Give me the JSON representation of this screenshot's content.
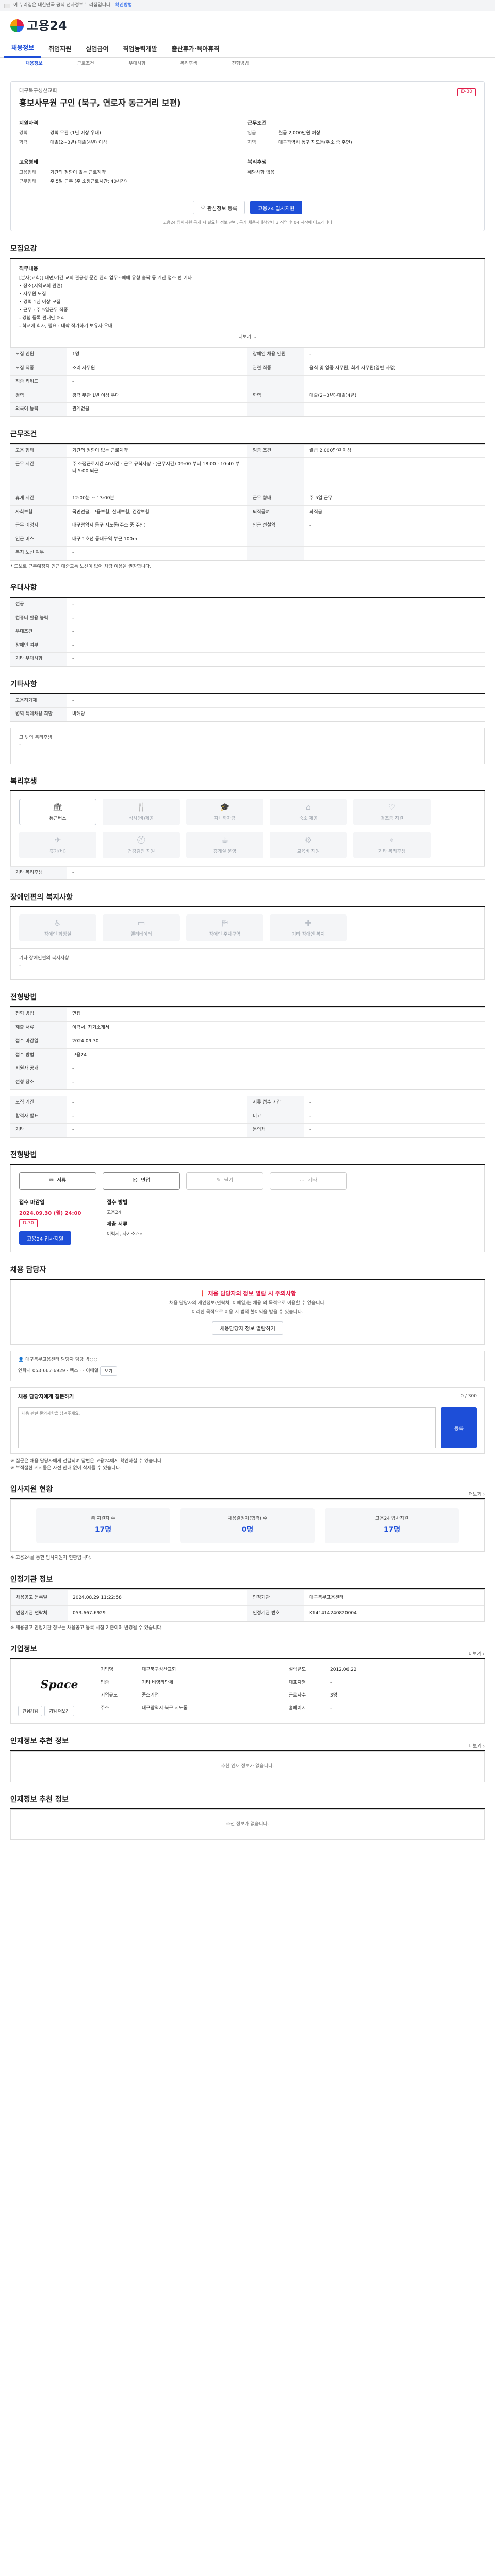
{
  "topbar": {
    "notice": "이 누리집은 대한민국 공식 전자정부 누리집입니다.",
    "how": "확인방법"
  },
  "brand": {
    "name": "고용24"
  },
  "nav": [
    "채용정보",
    "취업지원",
    "실업급여",
    "직업능력개발",
    "출산휴가·육아휴직"
  ],
  "subnav": [
    "채용정보",
    "근로조건",
    "우대사항",
    "복리후생",
    "전형방법"
  ],
  "hero": {
    "company": "대구북구성산교회",
    "dday": "D-30",
    "title": "홍보사무원 구인 (북구, 연로자 동근거리 보편)",
    "qual_h": "지원자격",
    "qual": [
      {
        "k": "경력",
        "v": "경력 무관 (1년 이상 우대)"
      },
      {
        "k": "학력",
        "v": "대졸(2~3년)·대졸(4년) 이상"
      }
    ],
    "cond_h": "근무조건",
    "cond": [
      {
        "k": "임금",
        "v": "월급 2,000만원 이상"
      },
      {
        "k": "지역",
        "v": "대구광역시 동구 지도동(주소 중 주인)"
      }
    ],
    "form_h": "고용형태",
    "form": [
      {
        "k": "고용형태",
        "v": "기간의 정함이 없는 근로계약"
      },
      {
        "k": "근무형태",
        "v": "주 5일 근무 (주 소정근로시간: 40시간)"
      }
    ],
    "welfare_h": "복리후생",
    "welfare": [
      {
        "k": "",
        "v": "해당사항 없음"
      }
    ],
    "btn_save": "관심정보 등록",
    "btn_apply": "고용24 입사지원",
    "note": "고용24 입사지원 공개 시 필요한 정보 관련, 공개 채용시대책안내 3 직업 후 04 시작에 에드리니다"
  },
  "recruit": {
    "title": "모집요강",
    "desc_head": "직무내용",
    "desc": [
      "[본사(교회)] 대면/기간 교회 관공청 문건 관리 업무~매매 유형 홀짝 등 계산 업소 편 기타",
      "• 장소(지역교회 관련)",
      "• 사무원 모집",
      "• 경력 1년 이상 모집",
      "• 근무 : 주 5일근무 직종",
      "- 경험 등록 관내만 처리",
      "- 학교에 회사, 필요 : 대학 작가하기 보유자 우대"
    ],
    "more": "더보기",
    "rows": [
      [
        "모집 인원",
        "1명",
        "장애인 채용 인원",
        "-"
      ],
      [
        "모집 직종",
        "조리 사무원",
        "관련 직종",
        "음식 및 업종 사무원, 회계 사무원(일반 사업)"
      ],
      [
        "직종 키워드",
        "-",
        "",
        ""
      ],
      [
        "경력",
        "경력 무관 1년 이상 우대",
        "학력",
        "대졸(2~3년)·대졸(4년)"
      ],
      [
        "외국어 능력",
        "관계없음",
        "",
        ""
      ]
    ]
  },
  "conditions": {
    "title": "근무조건",
    "rows": [
      [
        "고용 형태",
        "기간의 정함이 없는 근로계약",
        "임금 조건",
        "월급 2,000만원 이상"
      ],
      [
        "근무 시간",
        "주 소정근로시간 40시간 · 근무 규칙사항 · (근무시간) 09:00 부터 18:00 · 10:40 부터 5:00 퇴근",
        "",
        ""
      ],
      [
        "휴게 시간",
        "12:00분 ~ 13:00분",
        "근무 형태",
        "주 5일 근무"
      ],
      [
        "사회보험",
        "국민연금, 고용보험, 산재보험, 건강보험",
        "퇴직급여",
        "퇴직금"
      ],
      [
        "근무 예정지",
        "대구광역시 동구 지도동(주소 중 주인)",
        "인근 전철역",
        "-"
      ],
      [
        "인근 버스",
        "대구 1호선 동대구역 부근 100m",
        "",
        ""
      ],
      [
        "복지 노선 여부",
        "-",
        "",
        ""
      ]
    ],
    "note": "* 도보로 근무예정지 인근 대중교통 노선이 없어 차량 이용을 권장합니다."
  },
  "preference": {
    "title": "우대사항",
    "rows": [
      [
        "전공",
        "-"
      ],
      [
        "컴퓨터 활용 능력",
        "-"
      ],
      [
        "우대조건",
        "-"
      ],
      [
        "장애인 여부",
        "-"
      ],
      [
        "기타 우대사항",
        "-"
      ]
    ]
  },
  "other": {
    "title": "기타사항",
    "rows": [
      [
        "고용허가제",
        "-"
      ],
      [
        "병역 특례채용 희망",
        "비해당"
      ]
    ],
    "extra_label": "그 밖의 복리후생",
    "extra_value": "-"
  },
  "welfare": {
    "title": "복리후생",
    "items": [
      {
        "icon": "🏛",
        "label": "통근버스",
        "on": true
      },
      {
        "icon": "🍴",
        "label": "식사(비)제공",
        "on": false
      },
      {
        "icon": "🎓",
        "label": "자녀학자금",
        "on": false
      },
      {
        "icon": "⌂",
        "label": "숙소 제공",
        "on": false
      },
      {
        "icon": "♡",
        "label": "경조금 지원",
        "on": false
      },
      {
        "icon": "✈",
        "label": "휴가(비)",
        "on": false
      },
      {
        "icon": "⛑",
        "label": "건강검진 지원",
        "on": false
      },
      {
        "icon": "☕",
        "label": "휴게실 운영",
        "on": false
      },
      {
        "icon": "⚙",
        "label": "교육비 지원",
        "on": false
      },
      {
        "icon": "⌖",
        "label": "기타 복리후생",
        "on": false
      }
    ],
    "extra_label": "기타 복리후생",
    "extra_value": "-"
  },
  "disability": {
    "title": "장애인편의 복지사항",
    "items": [
      {
        "icon": "♿",
        "label": "장애인 화장실"
      },
      {
        "icon": "▭",
        "label": "엘리베이터"
      },
      {
        "icon": "⛿",
        "label": "장애인 주차구역"
      },
      {
        "icon": "✚",
        "label": "기타 장애인 복지"
      }
    ],
    "extra_label": "기타 장애인편의 복지사항",
    "extra_value": "-"
  },
  "process": {
    "title": "전형방법",
    "rows": [
      [
        "전형 방법",
        "면접"
      ],
      [
        "제출 서류",
        "이력서, 자기소개서"
      ],
      [
        "접수 마감일",
        "2024.09.30"
      ],
      [
        "접수 방법",
        "고용24"
      ],
      [
        "지원자 공개",
        "-"
      ],
      [
        "전형 장소",
        "-"
      ]
    ],
    "grid": [
      [
        "모집 기간",
        "-",
        "서류 접수 기간",
        "-"
      ],
      [
        "합격자 발표",
        "-",
        "비고",
        "-"
      ],
      [
        "기타",
        "-",
        "문의처",
        "-"
      ]
    ]
  },
  "apply": {
    "title": "전형방법",
    "methods": [
      {
        "icon": "✉",
        "label": "서류",
        "on": true
      },
      {
        "icon": "☺",
        "label": "면접",
        "on": true
      },
      {
        "icon": "✎",
        "label": "필기",
        "on": false
      },
      {
        "icon": "⋯",
        "label": "기타",
        "on": false
      }
    ],
    "period_h": "접수 마감일",
    "period": "2024.09.30 (월) 24:00",
    "dday": "D-30",
    "btn": "고용24 입사지원",
    "method_h": "접수 방법",
    "method": "고용24",
    "docs_h": "제출 서류",
    "docs": "이력서, 자기소개서"
  },
  "contact": {
    "title": "채용 담당자",
    "warn": "채용 담당자의 정보 열람 시 주의사항",
    "lines": [
      "채용 담당자의 개인정보(연락처, 이메일)는 채용 외 목적으로 이용할 수 없습니다.",
      "이러한 목적으로 이용 시 법적 불이익을 받을 수 있습니다."
    ],
    "btn": "채용담당자 정보 열람하기",
    "manager_label": "대구북부고용센터 담당자",
    "manager_name": "담당 박○○",
    "tel_label": "연락처",
    "tel": "053-667-6929",
    "fax_label": "팩스",
    "fax": "-",
    "email_label": "이메일",
    "email_btn": "보기",
    "inquiry_title": "채용 담당자에게 질문하기",
    "inquiry_note": "0 / 300",
    "inquiry_placeholder": "채용 관련 문의사항을 남겨주세요.",
    "inquiry_btn": "등록",
    "hints": [
      "※ 질문은 채용 담당자에게 전달되며 답변은 고용24에서 확인하실 수 있습니다.",
      "※ 부적절한 게시물은 사전 안내 없이 삭제될 수 있습니다."
    ]
  },
  "stats": {
    "title": "입사지원 현황",
    "link": "더보기 ›",
    "items": [
      {
        "label": "총 지원자 수",
        "num": "17명"
      },
      {
        "label": "채용결정자(합격) 수",
        "num": "0명"
      },
      {
        "label": "고용24 입사지원",
        "num": "17명"
      }
    ],
    "note": "※ 고용24를 통한 입사지원자 현황입니다."
  },
  "agency": {
    "title": "인정기관 정보",
    "rows": [
      [
        "채용공고 등록일",
        "2024.08.29 11:22:58",
        "인정기관",
        "대구북부고용센터"
      ],
      [
        "인정기관 연락처",
        "053-667-6929",
        "인정기관 번호",
        "K141414240820004"
      ]
    ],
    "note": "※ 채용공고 인정기관 정보는 채용공고 등록 시점 기준이며 변경될 수 있습니다."
  },
  "company": {
    "title": "기업정보",
    "link": "더보기 ›",
    "logo": "Space",
    "rows": [
      [
        "기업명",
        "대구북구성산교회",
        "설립년도",
        "2012.06.22"
      ],
      [
        "업종",
        "기타 비영리단체",
        "대표자명",
        "-"
      ],
      [
        "기업규모",
        "중소기업",
        "근로자수",
        "3명"
      ],
      [
        "주소",
        "대구광역시 북구 지도동",
        "홈페이지",
        "-"
      ]
    ],
    "btn1": "관심기업",
    "btn2": "기업 더보기"
  },
  "related": {
    "title": "인재정보 추천 정보",
    "link": "더보기 ›",
    "empty": "추천 인재 정보가 없습니다."
  },
  "recommend": {
    "title": "인재정보 추천 정보",
    "empty": "추천 정보가 없습니다."
  }
}
